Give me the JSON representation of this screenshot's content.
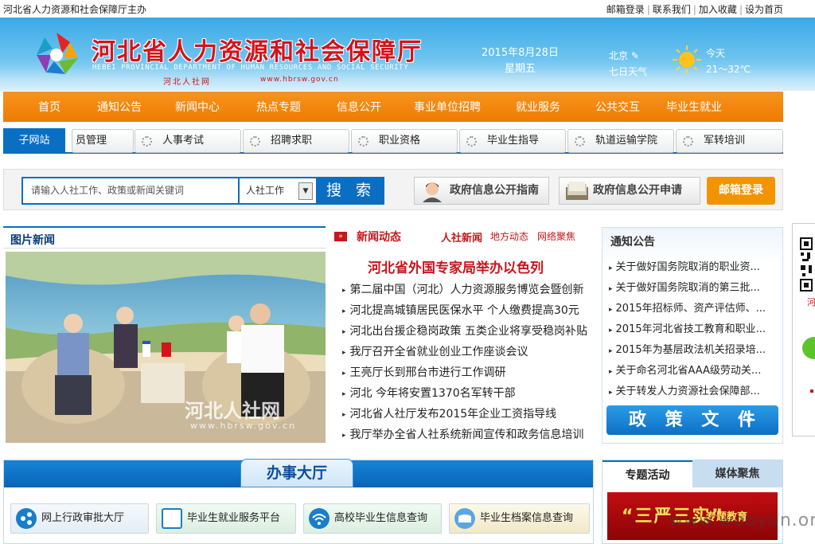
{
  "top": {
    "host": "河北省人力资源和社会保障厅主办",
    "links": [
      "邮箱登录",
      "联系我们",
      "加入收藏",
      "设为首页"
    ]
  },
  "header": {
    "title": "河北省人力资源和社会保障厅",
    "en": "HEBEI PROVINCIAL DEPARTMENT OF HUMAN RESOURCES AND SOCIAL SECURITY",
    "sub_cn": "河北人社网",
    "sub_url": "www.hbrsw.gov.cn",
    "date": "2015年8月28日",
    "weekday": "星期五",
    "city": "北京",
    "forecast": "七日天气",
    "today": "今天",
    "temp": "21～32℃"
  },
  "nav": [
    "首页",
    "通知公告",
    "新闻中心",
    "热点专题",
    "信息公开",
    "事业单位招聘",
    "就业服务",
    "公共交互",
    "毕业生就业"
  ],
  "subsites": {
    "tab": "子网站",
    "items": [
      "员管理",
      "人事考试",
      "招聘求职",
      "职业资格",
      "毕业生指导",
      "轨道运输学院",
      "军转培训"
    ]
  },
  "search": {
    "placeholder": "请输入人社工作、政策或新闻关键词",
    "select": "人社工作",
    "button": "搜 索",
    "guide": "政府信息公开指南",
    "apply": "政府信息公开申请",
    "mail": "邮箱登录"
  },
  "picnews": {
    "title": "图片新闻",
    "watermark": "河北人社网",
    "url": "www.hbrsw.gov.cn"
  },
  "news": {
    "title": "新闻动态",
    "tabs": [
      "人社新闻",
      "地方动态",
      "网络聚焦"
    ],
    "headline": "河北省外国专家局举办以色列",
    "items": [
      "第二届中国（河北）人力资源服务博览会暨创新",
      "河北提高城镇居民医保水平 个人缴费提高30元",
      "河北出台援企稳岗政策 五类企业将享受稳岗补贴",
      "我厅召开全省就业创业工作座谈会议",
      "王亮厅长到邢台市进行工作调研",
      "河北 今年将安置1370名军转干部",
      "河北省人社厅发布2015年企业工资指导线",
      "我厅举办全省人社系统新闻宣传和政务信息培训"
    ]
  },
  "notice": {
    "title": "通知公告",
    "items": [
      "关于做好国务院取消的职业资...",
      "关于做好国务院取消的第三批...",
      "2015年招标师、资产评估师、...",
      "2015年河北省技工教育和职业...",
      "2015年为基层政法机关招录培...",
      "关于命名河北省AAA级劳动关...",
      "关于转发人力资源社会保障部..."
    ],
    "policy": "政 策 文 件"
  },
  "float": {
    "label": "河"
  },
  "hall": {
    "title": "办事大厅",
    "buttons": [
      "网上行政审批大厅",
      "毕业生就业服务平台",
      "高校毕业生信息查询",
      "毕业生档案信息查询"
    ]
  },
  "special": {
    "tabs": [
      "专题活动",
      "媒体聚焦"
    ],
    "banner_main": "“三严三实”",
    "banner_sub": "专题教育"
  },
  "watermark": "www.wooyun.org",
  "colors": {
    "brand_blue": "#0a6fc2",
    "nav_orange": "#f7941d",
    "title_red": "#d4131b",
    "mail_orange": "#f29400"
  }
}
